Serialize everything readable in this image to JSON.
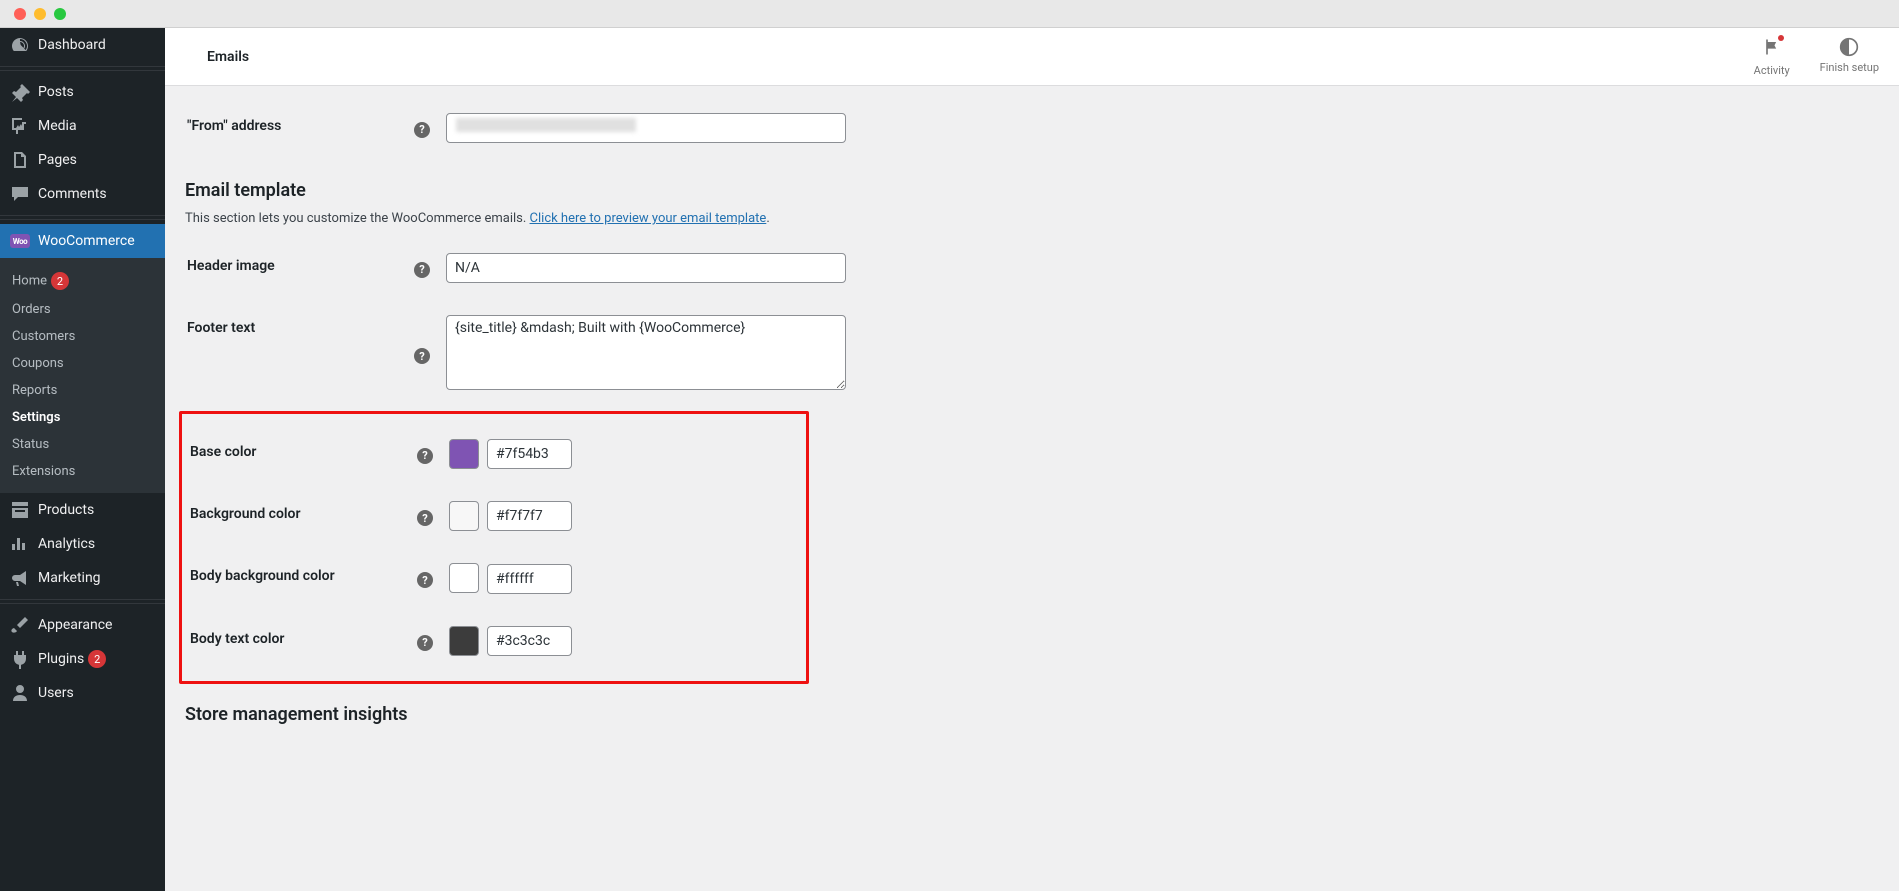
{
  "topbar": {
    "title": "Emails",
    "activity": "Activity",
    "finish_setup": "Finish setup"
  },
  "sidebar": {
    "dashboard": "Dashboard",
    "posts": "Posts",
    "media": "Media",
    "pages": "Pages",
    "comments": "Comments",
    "woocommerce": "WooCommerce",
    "sub": {
      "home": "Home",
      "home_badge": "2",
      "orders": "Orders",
      "customers": "Customers",
      "coupons": "Coupons",
      "reports": "Reports",
      "settings": "Settings",
      "status": "Status",
      "extensions": "Extensions"
    },
    "products": "Products",
    "analytics": "Analytics",
    "marketing": "Marketing",
    "appearance": "Appearance",
    "plugins": "Plugins",
    "plugins_badge": "2",
    "users": "Users"
  },
  "form": {
    "from_address_label": "\"From\" address",
    "from_address_value": "",
    "template_heading": "Email template",
    "template_desc_pre": "This section lets you customize the WooCommerce emails. ",
    "template_desc_link": "Click here to preview your email template",
    "template_desc_post": ".",
    "header_image_label": "Header image",
    "header_image_value": "N/A",
    "footer_text_label": "Footer text",
    "footer_text_value": "{site_title} &mdash; Built with {WooCommerce}",
    "base_color_label": "Base color",
    "base_color_value": "#7f54b3",
    "bg_color_label": "Background color",
    "bg_color_value": "#f7f7f7",
    "body_bg_label": "Body background color",
    "body_bg_value": "#ffffff",
    "body_text_label": "Body text color",
    "body_text_value": "#3c3c3c",
    "insights_heading": "Store management insights"
  },
  "colors": {
    "base": "#7f54b3",
    "bg": "#f7f7f7",
    "body_bg": "#ffffff",
    "body_text": "#3c3c3c"
  }
}
